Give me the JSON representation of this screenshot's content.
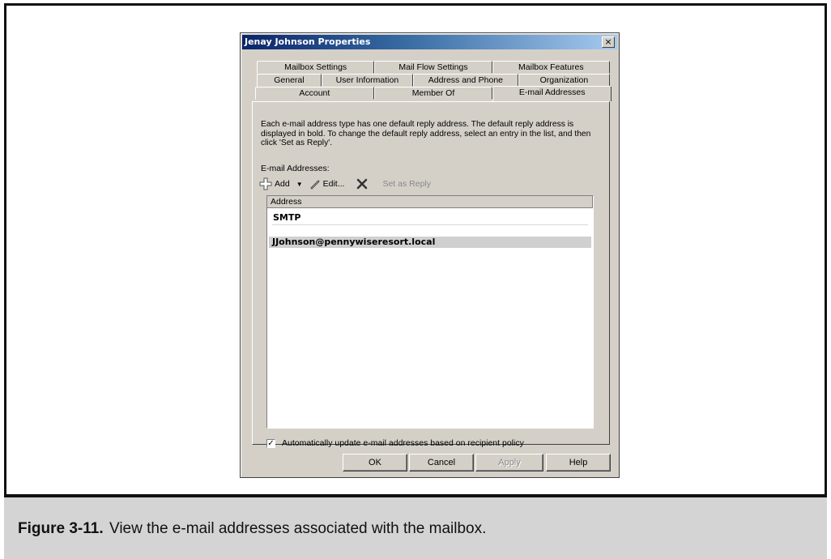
{
  "dialog": {
    "title": "Jenay Johnson Properties",
    "close_glyph": "×",
    "tabs_row1": [
      "Mailbox Settings",
      "Mail Flow Settings",
      "Mailbox Features"
    ],
    "tabs_row2": [
      "General",
      "User Information",
      "Address and Phone",
      "Organization"
    ],
    "tabs_row3": [
      "Account",
      "Member Of",
      "E-mail Addresses"
    ],
    "active_tab": "E-mail Addresses",
    "description": "Each e-mail address type has one default reply address. The default reply address is displayed in bold. To change the default reply address, select an entry in the list, and then click 'Set as Reply'.",
    "emails_label": "E-mail Addresses:",
    "toolbar": {
      "add_label": "Add",
      "add_icon": "add-icon",
      "edit_label": "Edit...",
      "edit_icon": "edit-icon",
      "remove_icon": "remove-icon",
      "set_reply_label": "Set as Reply"
    },
    "list": {
      "column_header": "Address",
      "group": "SMTP",
      "entries": [
        "JJohnson@pennywiseresort.local"
      ]
    },
    "auto_update_label": "Automatically update e-mail addresses based on recipient policy",
    "auto_update_checked": true,
    "buttons": {
      "ok": "OK",
      "cancel": "Cancel",
      "apply": "Apply",
      "help": "Help"
    }
  },
  "caption": {
    "number": "Figure 3-11.",
    "text": "View the e-mail addresses associated with the mailbox."
  },
  "colors": {
    "titlebar_start": "#0a246a",
    "titlebar_end": "#a6caf0",
    "dialog_face": "#d4d0c8",
    "caption_band": "#d4d4d4"
  }
}
